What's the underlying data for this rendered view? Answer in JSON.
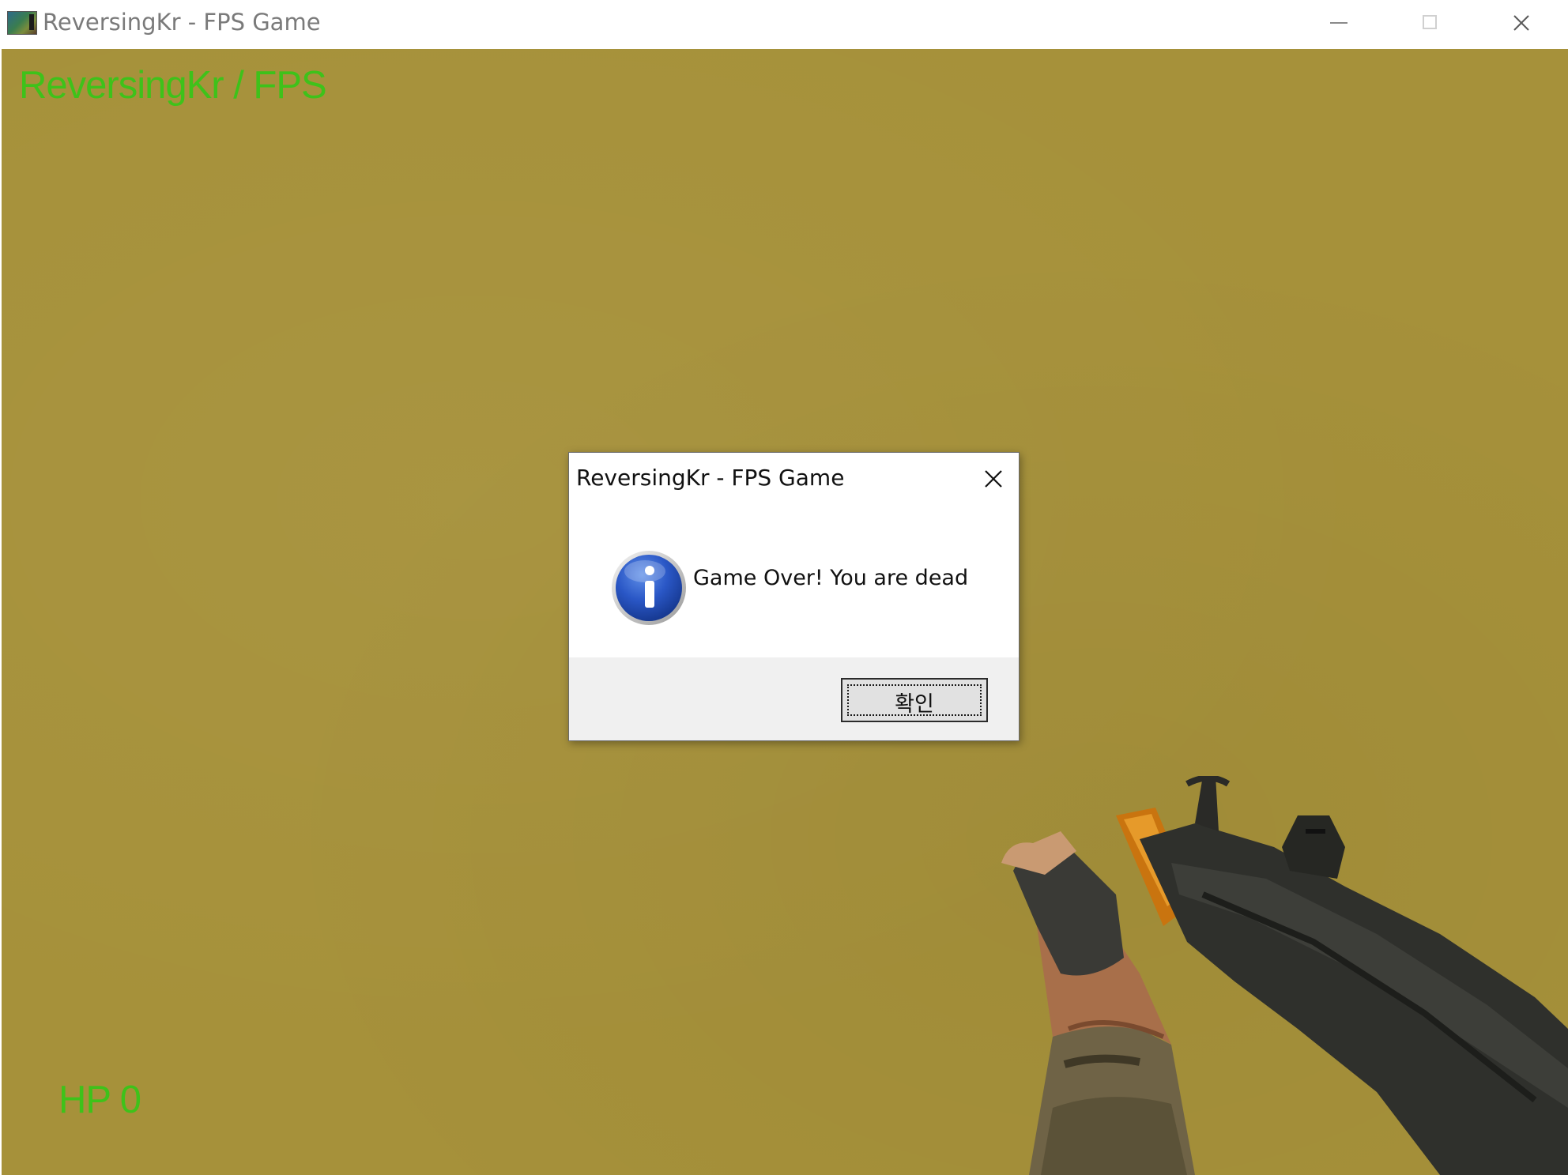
{
  "window": {
    "title": "ReversingKr - FPS Game",
    "icon": "app-icon",
    "controls": [
      "minimize-icon",
      "maximize-icon",
      "close-icon"
    ]
  },
  "game": {
    "hud_title": "ReversingKr / FPS",
    "hp_label": "HP 0",
    "hud_color": "#3ec21a",
    "sky_color": "#a6913a",
    "weapon": "rifle-viewmodel"
  },
  "dialog": {
    "title": "ReversingKr - FPS Game",
    "message": "Game Over! You are dead",
    "icon": "info-icon",
    "ok_label": "확인"
  }
}
